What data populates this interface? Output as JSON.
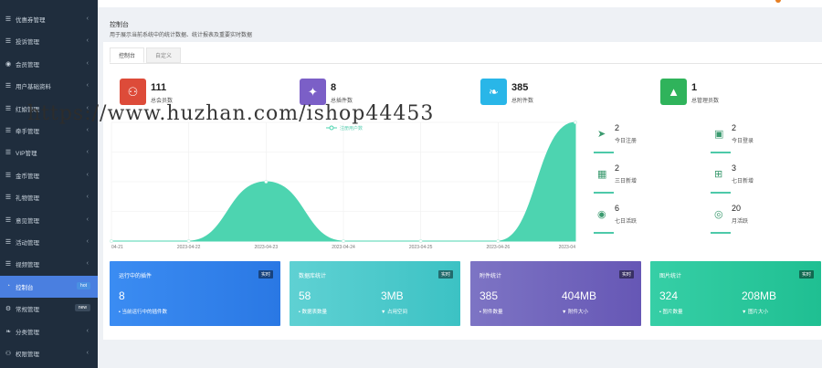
{
  "sidebar": {
    "items": [
      {
        "label": "优惠券管理",
        "icon": "list-icon"
      },
      {
        "label": "投诉管理",
        "icon": "list-icon"
      },
      {
        "label": "会员管理",
        "icon": "user-circle-icon"
      },
      {
        "label": "用户基础资料",
        "icon": "list-icon"
      },
      {
        "label": "红娘管理",
        "icon": "list-icon"
      },
      {
        "label": "牵手管理",
        "icon": "list-icon"
      },
      {
        "label": "VIP管理",
        "icon": "list-icon"
      },
      {
        "label": "金币管理",
        "icon": "list-icon"
      },
      {
        "label": "礼物管理",
        "icon": "list-icon"
      },
      {
        "label": "意见管理",
        "icon": "list-icon"
      },
      {
        "label": "活动管理",
        "icon": "list-icon"
      },
      {
        "label": "视频管理",
        "icon": "list-icon"
      },
      {
        "label": "控制台",
        "icon": "dashboard-icon",
        "badge": "hot",
        "badge_color": "#4a90e2"
      },
      {
        "label": "常规管理",
        "icon": "cogs-icon",
        "badge": "new",
        "badge_color": "#3a4a5c"
      },
      {
        "label": "分类管理",
        "icon": "leaf-icon"
      },
      {
        "label": "权限管理",
        "icon": "users-icon"
      }
    ]
  },
  "header": {
    "title": "控制台",
    "subtitle": "用于展示当前系统中的统计数据、统计报表及重要实时数据"
  },
  "tabs": [
    "控制台",
    "自定义"
  ],
  "top_stats": [
    {
      "value": "111",
      "label": "总会员数",
      "color": "#dd4b39",
      "icon": "users-icon"
    },
    {
      "value": "8",
      "label": "总插件数",
      "color": "#7b5fc7",
      "icon": "magic-wand-icon"
    },
    {
      "value": "385",
      "label": "总附件数",
      "color": "#29b6e8",
      "icon": "leaf-icon"
    },
    {
      "value": "1",
      "label": "总管理员数",
      "color": "#2fb35b",
      "icon": "user-icon"
    }
  ],
  "watermark": "https://www.huzhan.com/ishop44453",
  "chart_data": {
    "type": "area",
    "legend": "注册用户数",
    "categories": [
      "04-21",
      "2023-04-22",
      "2023-04-23",
      "2023-04-24",
      "2023-04-25",
      "2023-04-26",
      "2023-04"
    ],
    "values": [
      0,
      0,
      1,
      0,
      0,
      0,
      2
    ],
    "color": "#4dd4b0"
  },
  "mini_stats": [
    {
      "value": "2",
      "label": "今日注册",
      "icon": "rocket-icon"
    },
    {
      "value": "2",
      "label": "今日登录",
      "icon": "id-card-icon"
    },
    {
      "value": "2",
      "label": "三日新增",
      "icon": "calendar-icon"
    },
    {
      "value": "3",
      "label": "七日新增",
      "icon": "calendar-plus-icon"
    },
    {
      "value": "6",
      "label": "七日活跃",
      "icon": "user-circle-icon"
    },
    {
      "value": "20",
      "label": "月活跃",
      "icon": "user-circle-o-icon"
    }
  ],
  "cards": [
    {
      "title": "运行中的插件",
      "tag": "实时",
      "v1": "8",
      "l1": "当前运行中的插件数",
      "v2": "",
      "l2": "",
      "bg": "linear-gradient(90deg,#3b8cf2,#2a78e4)"
    },
    {
      "title": "数据库统计",
      "tag": "实时",
      "v1": "58",
      "l1": "数据表数量",
      "v2": "3MB",
      "l2": "占用空间",
      "bg": "linear-gradient(90deg,#5fd1d3,#3cc2c4)"
    },
    {
      "title": "附件统计",
      "tag": "实时",
      "v1": "385",
      "l1": "附件数量",
      "v2": "404MB",
      "l2": "附件大小",
      "bg": "linear-gradient(90deg,#7d74c4,#6657b5)"
    },
    {
      "title": "图片统计",
      "tag": "实时",
      "v1": "324",
      "l1": "图片数量",
      "v2": "208MB",
      "l2": "图片大小",
      "bg": "linear-gradient(90deg,#36cfa6,#1fbf92)"
    }
  ]
}
